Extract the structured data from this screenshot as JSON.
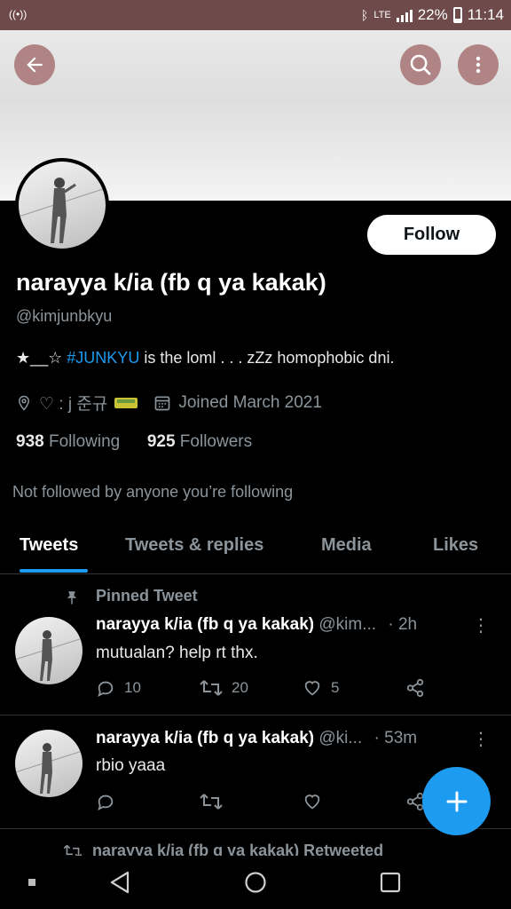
{
  "status_bar": {
    "lte": "LTE",
    "battery": "22%",
    "time": "11:14"
  },
  "profile": {
    "name": "narayya k/ia (fb q ya kakak)",
    "handle": "@kimjunbkyu",
    "follow_label": "Follow",
    "bio_prefix": "★__☆ ",
    "bio_hashtag": "#JUNKYU",
    "bio_suffix": " is the loml . . . zZz homophobic dni.",
    "location": "♡ : j 준규",
    "joined": "Joined March 2021",
    "following_count": "938",
    "following_label": "Following",
    "followers_count": "925",
    "followers_label": "Followers",
    "not_followed": "Not followed by anyone you’re following"
  },
  "tabs": [
    {
      "label": "Tweets",
      "active": true
    },
    {
      "label": "Tweets & replies",
      "active": false
    },
    {
      "label": "Media",
      "active": false
    },
    {
      "label": "Likes",
      "active": false
    }
  ],
  "tweets": [
    {
      "pinned_label": "Pinned Tweet",
      "name": "narayya k/ia (fb q ya kakak)",
      "handle": "@kim...",
      "time": "· 2h",
      "text": "mutualan? help rt thx.",
      "replies": "10",
      "retweets": "20",
      "likes": "5"
    },
    {
      "name": "narayya k/ia (fb q ya kakak)",
      "handle": "@ki...",
      "time": "· 53m",
      "text": "rbio yaaa"
    }
  ],
  "retweeted_label": "narayya k/ia (fb q ya kakak) Retweeted",
  "colors": {
    "accent": "#1d9bf0",
    "status_bar": "#6e4a4b",
    "header_button": "#b08485",
    "background": "#000000",
    "secondary_text": "#8b949a"
  }
}
